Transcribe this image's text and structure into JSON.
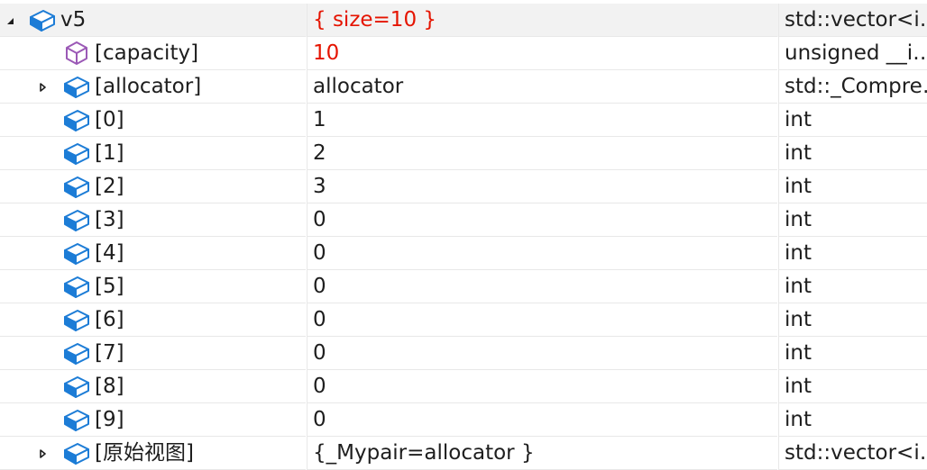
{
  "watch": {
    "rows": [
      {
        "name": "v5",
        "value": "{ size=10 }",
        "type": "std::vector<i…",
        "depth": 0,
        "expander": "expanded",
        "icon": "field-icon",
        "value_changed": true,
        "selected": true
      },
      {
        "name": "[capacity]",
        "value": "10",
        "type": "unsigned __i…",
        "depth": 1,
        "expander": "none",
        "icon": "property-icon",
        "value_changed": true,
        "selected": false
      },
      {
        "name": "[allocator]",
        "value": "allocator",
        "type": "std::_Compre…",
        "depth": 1,
        "expander": "collapsed",
        "icon": "field-icon",
        "value_changed": false,
        "selected": false
      },
      {
        "name": "[0]",
        "value": "1",
        "type": "int",
        "depth": 1,
        "expander": "none",
        "icon": "field-icon",
        "value_changed": false,
        "selected": false
      },
      {
        "name": "[1]",
        "value": "2",
        "type": "int",
        "depth": 1,
        "expander": "none",
        "icon": "field-icon",
        "value_changed": false,
        "selected": false
      },
      {
        "name": "[2]",
        "value": "3",
        "type": "int",
        "depth": 1,
        "expander": "none",
        "icon": "field-icon",
        "value_changed": false,
        "selected": false
      },
      {
        "name": "[3]",
        "value": "0",
        "type": "int",
        "depth": 1,
        "expander": "none",
        "icon": "field-icon",
        "value_changed": false,
        "selected": false
      },
      {
        "name": "[4]",
        "value": "0",
        "type": "int",
        "depth": 1,
        "expander": "none",
        "icon": "field-icon",
        "value_changed": false,
        "selected": false
      },
      {
        "name": "[5]",
        "value": "0",
        "type": "int",
        "depth": 1,
        "expander": "none",
        "icon": "field-icon",
        "value_changed": false,
        "selected": false
      },
      {
        "name": "[6]",
        "value": "0",
        "type": "int",
        "depth": 1,
        "expander": "none",
        "icon": "field-icon",
        "value_changed": false,
        "selected": false
      },
      {
        "name": "[7]",
        "value": "0",
        "type": "int",
        "depth": 1,
        "expander": "none",
        "icon": "field-icon",
        "value_changed": false,
        "selected": false
      },
      {
        "name": "[8]",
        "value": "0",
        "type": "int",
        "depth": 1,
        "expander": "none",
        "icon": "field-icon",
        "value_changed": false,
        "selected": false
      },
      {
        "name": "[9]",
        "value": "0",
        "type": "int",
        "depth": 1,
        "expander": "none",
        "icon": "field-icon",
        "value_changed": false,
        "selected": false
      },
      {
        "name": "[原始视图]",
        "value": "{_Mypair=allocator }",
        "type": "std::vector<i…",
        "depth": 1,
        "expander": "collapsed",
        "icon": "field-icon",
        "value_changed": false,
        "selected": false
      }
    ]
  },
  "colors": {
    "changed_value": "#e51400",
    "field_icon": "#1c7cd6",
    "property_icon": "#9b59b6",
    "grid_line": "#e8e8e8",
    "selected_row": "#f2f2f2"
  }
}
